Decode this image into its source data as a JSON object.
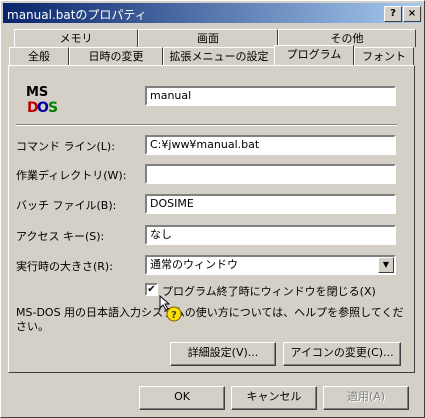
{
  "window": {
    "title": "manual.batのプロパティ"
  },
  "title_buttons": {
    "help": "?",
    "close": "×"
  },
  "tabs_back": [
    "メモリ",
    "画面",
    "その他"
  ],
  "tabs_front": [
    "全般",
    "日時の変更",
    "拡張メニューの設定",
    "プログラム",
    "フォント"
  ],
  "program": {
    "name": "manual",
    "command_label": "コマンド ライン(L):",
    "command_value": "C:¥jww¥manual.bat",
    "workdir_label": "作業ディレクトリ(W):",
    "workdir_value": "",
    "batch_label": "バッチ ファイル(B):",
    "batch_value": "DOSIME",
    "shortcut_label": "アクセス キー(S):",
    "shortcut_value": "なし",
    "run_label": "実行時の大きさ(R):",
    "run_value": "通常のウィンドウ",
    "close_on_exit_label": "プログラム終了時にウィンドウを閉じる(X)",
    "close_on_exit_checked": "✔",
    "help_text": "MS-DOS 用の日本語入力システムの使い方については、ヘルプを参照してください。",
    "advanced_button": "詳細設定(V)...",
    "change_icon_button": "アイコンの変更(C)..."
  },
  "footer": {
    "ok": "OK",
    "cancel": "キャンセル",
    "apply": "適用(A)"
  },
  "colors": {
    "titlebar_start": "#08246b",
    "titlebar_end": "#a6caf0",
    "face": "#d4d0c8"
  }
}
